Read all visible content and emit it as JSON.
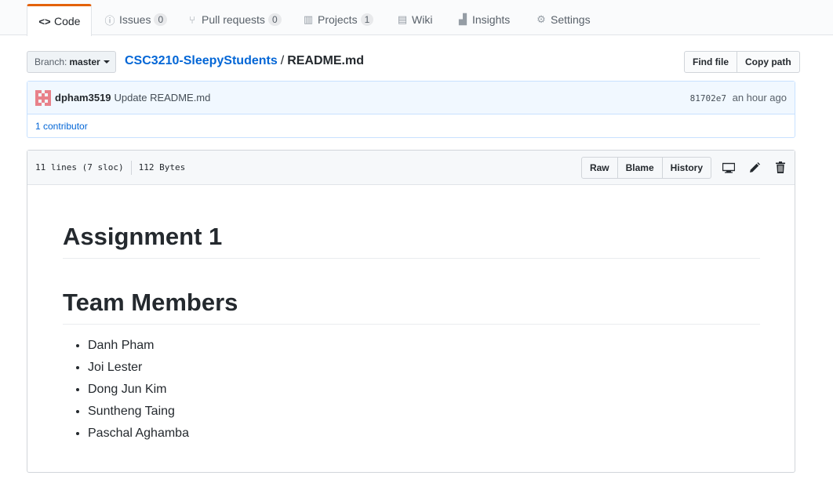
{
  "nav": {
    "tabs": [
      {
        "label": "Code",
        "icon": "code-icon",
        "counter": null
      },
      {
        "label": "Issues",
        "icon": "issue-opened-icon",
        "counter": "0"
      },
      {
        "label": "Pull requests",
        "icon": "git-pull-request-icon",
        "counter": "0"
      },
      {
        "label": "Projects",
        "icon": "project-icon",
        "counter": "1"
      },
      {
        "label": "Wiki",
        "icon": "book-icon",
        "counter": null
      },
      {
        "label": "Insights",
        "icon": "graph-icon",
        "counter": null
      },
      {
        "label": "Settings",
        "icon": "gear-icon",
        "counter": null
      }
    ],
    "selected": "Code"
  },
  "branch": {
    "label": "Branch:",
    "value": "master"
  },
  "breadcrumb": {
    "repo": "CSC3210-SleepyStudents",
    "separator": "/",
    "file": "README.md"
  },
  "file_nav_buttons": {
    "find_file": "Find file",
    "copy_path": "Copy path"
  },
  "commit": {
    "author": "dpham3519",
    "message": "Update README.md",
    "sha": "81702e7",
    "time": "an hour ago",
    "contributors": "1 contributor"
  },
  "file": {
    "lines": "11 lines (7 sloc)",
    "size": "112 Bytes",
    "buttons": {
      "raw": "Raw",
      "blame": "Blame",
      "history": "History"
    },
    "action_icons": [
      "device-desktop-icon",
      "pencil-icon",
      "trashcan-icon"
    ]
  },
  "readme": {
    "heading1": "Assignment 1",
    "heading2": "Team Members",
    "members": [
      "Danh Pham",
      "Joi Lester",
      "Dong Jun Kim",
      "Suntheng Taing",
      "Paschal Aghamba"
    ]
  },
  "colors": {
    "accent": "#e36209",
    "link": "#0366d6",
    "commit_bg": "#f1f8ff",
    "commit_border": "#c8e1ff"
  }
}
